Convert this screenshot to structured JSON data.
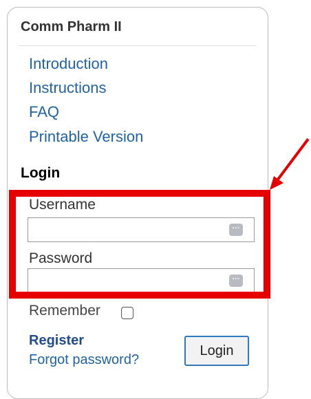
{
  "course": {
    "title": "Comm Pharm II"
  },
  "nav": {
    "items": [
      {
        "label": "Introduction"
      },
      {
        "label": "Instructions"
      },
      {
        "label": "FAQ"
      },
      {
        "label": "Printable Version"
      }
    ]
  },
  "login": {
    "title": "Login",
    "username_label": "Username",
    "username_value": "",
    "password_label": "Password",
    "password_value": "",
    "remember_label": "Remember",
    "register_label": "Register",
    "forgot_label": "Forgot password?",
    "submit_label": "Login",
    "password_manager_icon": "ellipsis-key-icon"
  },
  "colors": {
    "link": "#1f63a6",
    "annotation_red": "#e60000",
    "button_border": "#2f78bb"
  }
}
